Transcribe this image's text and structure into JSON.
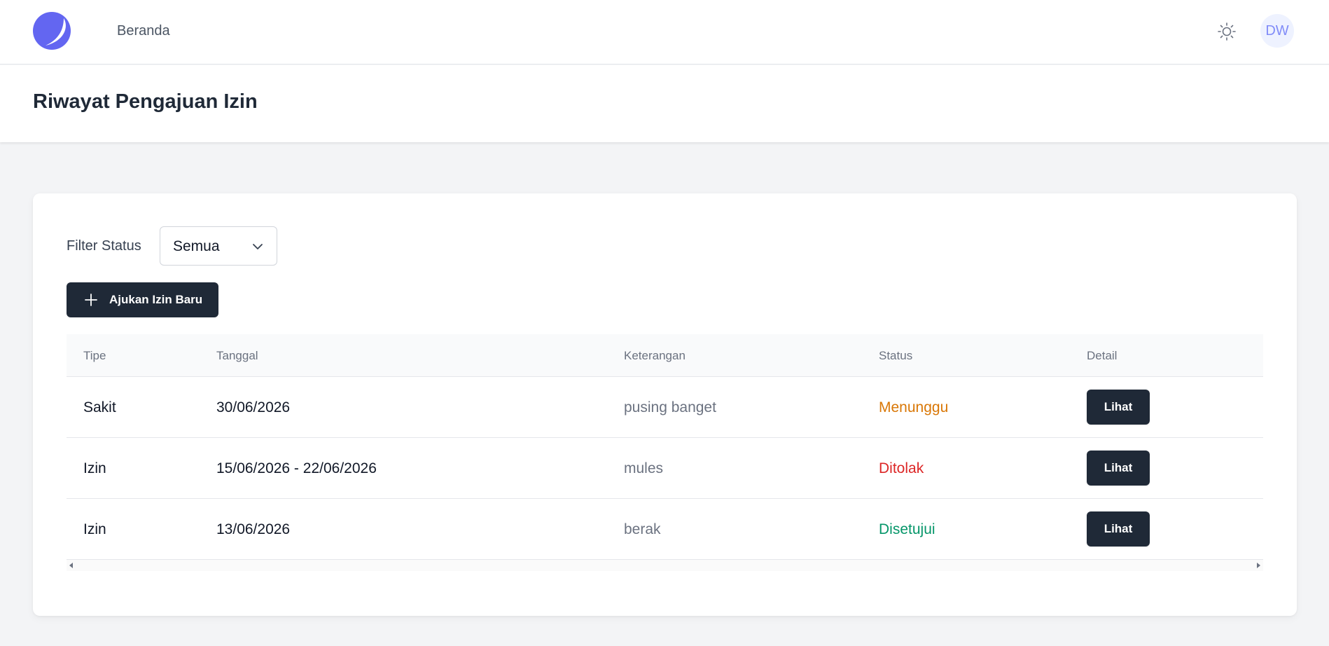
{
  "nav": {
    "logo_icon": "crescent-logo",
    "home_label": "Beranda",
    "theme_icon": "sun-icon",
    "avatar_initials": "DW"
  },
  "header": {
    "title": "Riwayat Pengajuan Izin"
  },
  "filter": {
    "label": "Filter Status",
    "selected": "Semua",
    "icon": "chevron-down-icon"
  },
  "actions": {
    "new_request_label": "Ajukan Izin Baru",
    "new_request_icon": "plus-icon"
  },
  "table": {
    "columns": [
      "Tipe",
      "Tanggal",
      "Keterangan",
      "Status",
      "Detail"
    ],
    "rows": [
      {
        "type": "Sakit",
        "date": "30/06/2026",
        "description": "pusing banget",
        "status": "Menunggu",
        "action": "Lihat"
      },
      {
        "type": "Izin",
        "date": "15/06/2026 - 22/06/2026",
        "description": "mules",
        "status": "Ditolak",
        "action": "Lihat"
      },
      {
        "type": "Izin",
        "date": "13/06/2026",
        "description": "berak",
        "status": "Disetujui",
        "action": "Lihat"
      }
    ]
  },
  "colors": {
    "accent": "#6366f1",
    "dark_button": "#1f2937",
    "status_waiting": "#d97706",
    "status_rejected": "#dc2626",
    "status_approved": "#059669"
  }
}
